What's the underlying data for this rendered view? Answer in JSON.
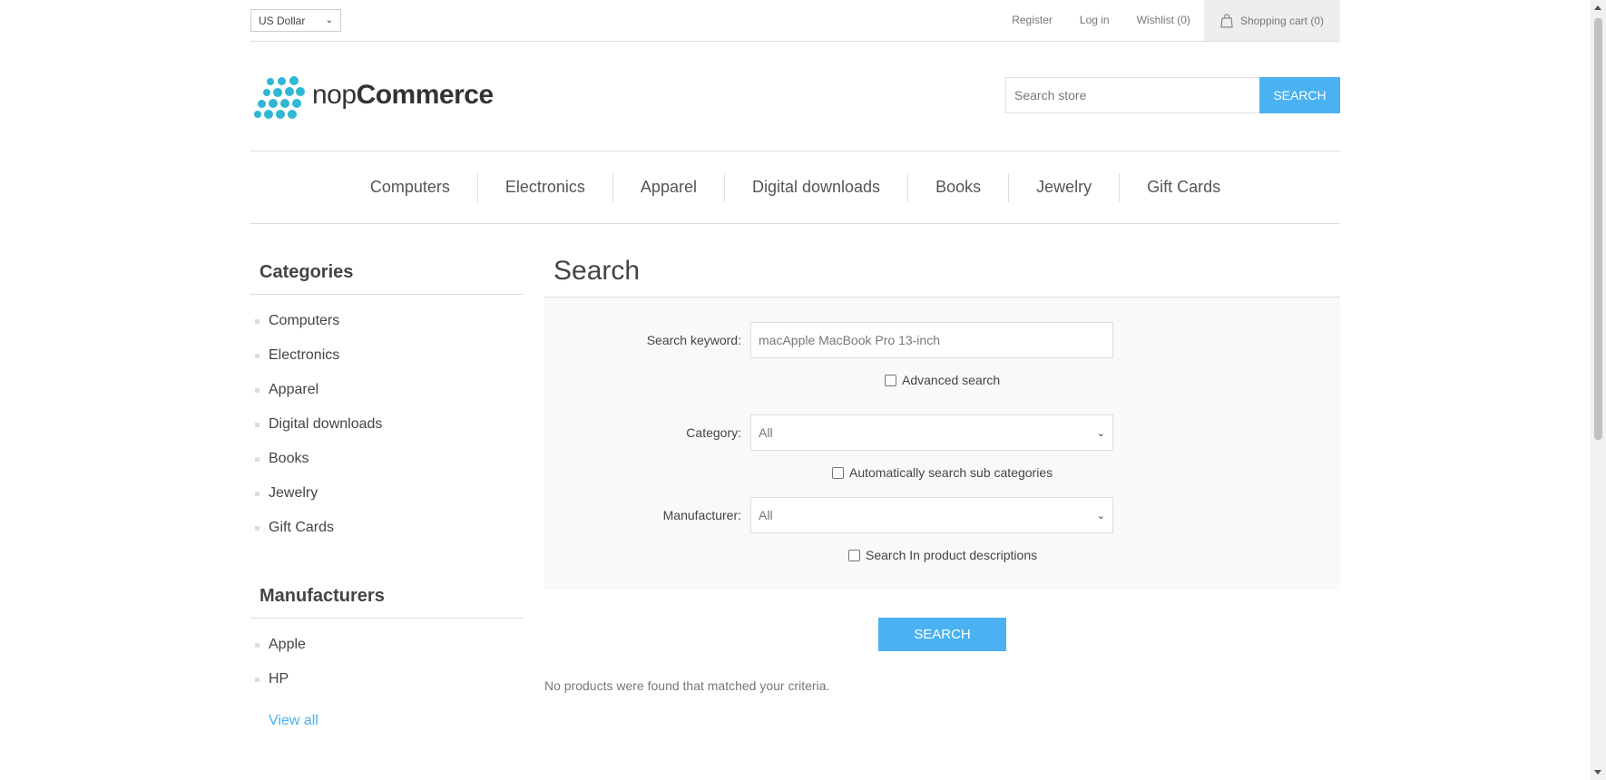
{
  "header": {
    "currency": "US Dollar",
    "links": {
      "register": "Register",
      "login": "Log in",
      "wishlist": "Wishlist (0)",
      "cart": "Shopping cart (0)"
    }
  },
  "logo": {
    "prefix": "nop",
    "suffix": "Commerce"
  },
  "search": {
    "placeholder": "Search store",
    "button": "SEARCH"
  },
  "menu": [
    "Computers",
    "Electronics",
    "Apparel",
    "Digital downloads",
    "Books",
    "Jewelry",
    "Gift Cards"
  ],
  "sidebar": {
    "categories_title": "Categories",
    "categories": [
      "Computers",
      "Electronics",
      "Apparel",
      "Digital downloads",
      "Books",
      "Jewelry",
      "Gift Cards"
    ],
    "manufacturers_title": "Manufacturers",
    "manufacturers": [
      "Apple",
      "HP"
    ],
    "view_all": "View all"
  },
  "main": {
    "title": "Search",
    "keyword_label": "Search keyword:",
    "keyword_value": "macApple MacBook Pro 13-inch",
    "advanced_label": "Advanced search",
    "category_label": "Category:",
    "category_value": "All",
    "subcat_label": "Automatically search sub categories",
    "manufacturer_label": "Manufacturer:",
    "manufacturer_value": "All",
    "desc_label": "Search In product descriptions",
    "search_button": "SEARCH",
    "no_results": "No products were found that matched your criteria."
  },
  "colors": {
    "accent": "#4ab2f1",
    "logo": "#2fb7d4"
  }
}
